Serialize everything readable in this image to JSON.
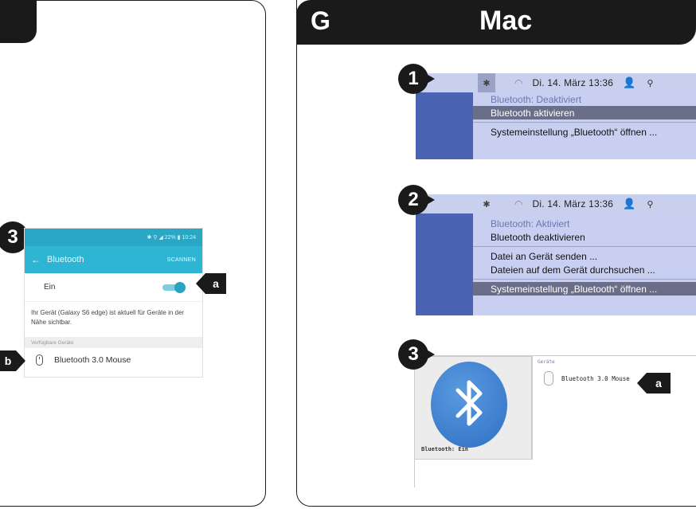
{
  "left": {
    "step3": "3",
    "android": {
      "status": "✱ ⚲ ◢ 22% ▮ 10:24",
      "title": "Bluetooth",
      "scan": "SCANNEN",
      "ein_label": "Ein",
      "info": "Ihr Gerät (Galaxy S6 edge) ist aktuell für Geräte in der Nähe sichtbar.",
      "section": "Verfügbare Geräte",
      "device": "Bluetooth 3.0 Mouse"
    },
    "tag_a": "a",
    "tag_b": "b"
  },
  "right": {
    "letter": "G",
    "title": "Mac",
    "step1": "1",
    "step2": "2",
    "step3": "3",
    "menubar": {
      "datetime": "Di. 14. März  13:36",
      "bt_icon": "✱",
      "wifi_icon": "◠",
      "person_icon": "👤",
      "search_icon": "⚲"
    },
    "menu1": {
      "item1": "Bluetooth: Deaktiviert",
      "item2": "Bluetooth aktivieren",
      "item3": "Systemeinstellung „Bluetooth“ öffnen ..."
    },
    "menu2": {
      "item1": "Bluetooth: Aktiviert",
      "item2": "Bluetooth deaktivieren",
      "item3": "Datei an Gerät senden ...",
      "item4": "Dateien auf dem Gerät durchsuchen ...",
      "item5": "Systemeinstellung „Bluetooth“ öffnen ..."
    },
    "prefs": {
      "status": "Bluetooth: Ein",
      "section": "Geräte",
      "device": "Bluetooth 3.0 Mouse"
    },
    "tag_a": "a"
  },
  "colors": {
    "android_teal": "#2fb5d4",
    "mac_menu": "#c8cff0",
    "highlight": "#6a6e88",
    "dark": "#1a1a1a"
  }
}
